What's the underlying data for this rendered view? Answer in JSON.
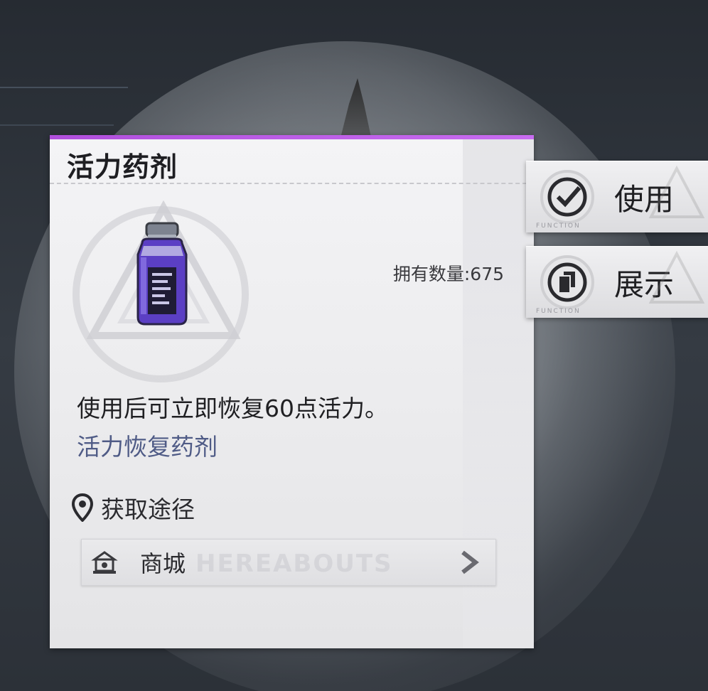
{
  "item": {
    "name": "活力药剂",
    "owned_label": "拥有数量:675",
    "description": "使用后可立即恢复60点活力。",
    "type_label": "活力恢复药剂",
    "rarity_color": "#b04fdc",
    "icon": "energy-potion-bottle-icon"
  },
  "source": {
    "header": "获取途径",
    "items": [
      {
        "label": "商城",
        "icon": "shop-icon",
        "watermark": "HEREABOUTS"
      }
    ]
  },
  "actions": [
    {
      "label": "使用",
      "icon": "check-circle-icon",
      "tag": "FUNCTION"
    },
    {
      "label": "展示",
      "icon": "cards-circle-icon",
      "tag": "FUNCTION"
    }
  ]
}
